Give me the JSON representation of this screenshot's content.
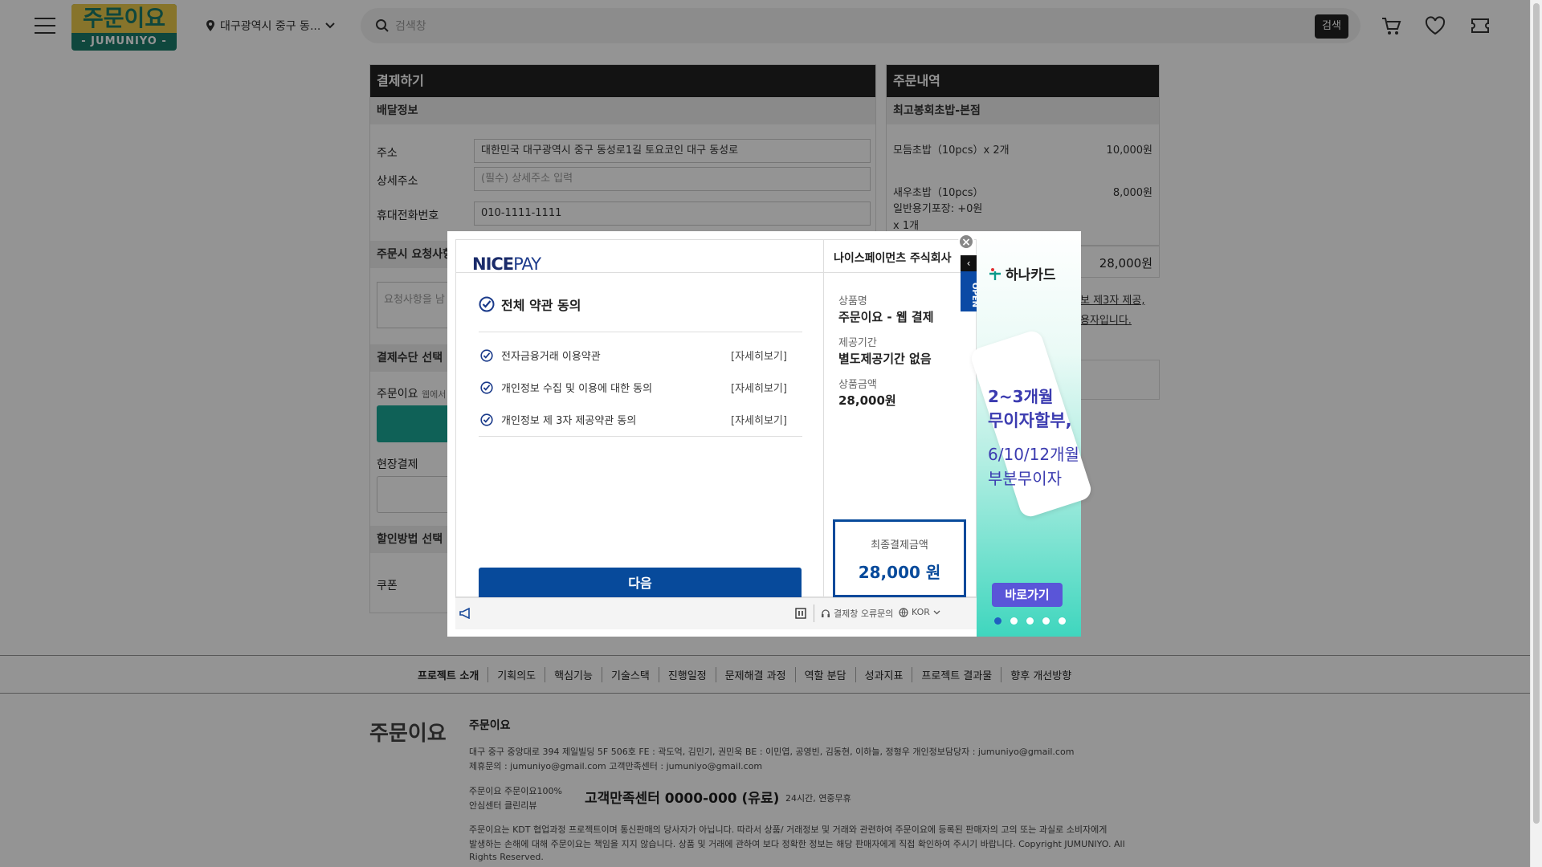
{
  "header": {
    "location": "대구광역시 중구 동...",
    "search_placeholder": "검색창",
    "search_button": "검색",
    "logo_top": "주문이요",
    "logo_bottom": "- JUMUNIYO -"
  },
  "checkout": {
    "title": "결제하기",
    "delivery_section": "배달정보",
    "address_label": "주소",
    "address_value": "대한민국 대구광역시 중구 동성로1길 토요코인 대구 동성로",
    "detail_label": "상세주소",
    "detail_placeholder": "(필수) 상세주소 입력",
    "phone_label": "휴대전화번호",
    "phone_value": "010-1111-1111",
    "request_section": "주문시 요청사항",
    "request_placeholder": "요청사항을 남",
    "payment_section": "결제수단 선택",
    "jumuniyo_label": "주문이요",
    "jumuniyo_sub": "웹에서",
    "onsite_label": "현장결제",
    "discount_section": "할인방법 선택",
    "coupon_label": "쿠폰"
  },
  "order": {
    "title": "주문내역",
    "store": "최고봉회초밥-본점",
    "items": [
      {
        "name": "모듬초밥（10pcs）x 2개",
        "price": "10,000원"
      },
      {
        "name": "새우초밥（10pcs）",
        "price": "8,000원",
        "opt": "일반용기포장: +0원",
        "qty": "x 1개"
      }
    ],
    "total": "28,000원",
    "notice1": "보 제3자 제공,",
    "notice2": "용자입니다."
  },
  "modal": {
    "brand_a": "NICE",
    "brand_b": "PAY",
    "agree_all": "전체 약관 동의",
    "terms": [
      {
        "label": "전자금융거래 이용약관",
        "detail": "[자세히보기]"
      },
      {
        "label": "개인정보 수집 및 이용에 대한 동의",
        "detail": "[자세히보기]"
      },
      {
        "label": "개인정보 제 3자 제공약관 동의",
        "detail": "[자세히보기]"
      }
    ],
    "next": "다음",
    "company": "나이스페이먼츠 주식회사",
    "product_label": "상품명",
    "product_value": "주문이요 - 웹 결제",
    "period_label": "제공기간",
    "period_value": "별도제공기간 없음",
    "amount_label": "상품금액",
    "amount_value": "28,000원",
    "final_label": "최종결제금액",
    "final_value": "28,000 원",
    "error_report": "결제창 오류문의",
    "lang": "KOR",
    "open_tab": "OPEN"
  },
  "ad": {
    "brand": "하나카드",
    "line1": "2~3개월",
    "line2": "무이자할부,",
    "line3": "6/10/12개월",
    "line4": "부분무이자",
    "go": "바로가기"
  },
  "footer": {
    "nav": [
      "프로젝트 소개",
      "기획의도",
      "핵심기능",
      "기술스택",
      "진행일정",
      "문제해결 과정",
      "역할 분담",
      "성과지표",
      "프로젝트 결과물",
      "향후 개선방향"
    ],
    "logo": "주문이요",
    "title": "주문이요",
    "addr": "대구 중구 중앙대로 394 제일빌딩 5F 506호    FE : 곽도억, 김민기, 권민욱    BE : 이민엽, 공영빈, 김동현, 이하늘, 정형우    개인정보담당자 : jumuniyo@gmail.com",
    "contact": "제휴문의 : jumuniyo@gmail.com    고객만족센터 : jumuniyo@gmail.com",
    "links1": "주문이요    주문이요100%",
    "links2": "안심센터    클린리뷰",
    "cs": "고객만족센터 0000-000 (유료)",
    "cs_hours": "24시간, 연중무휴",
    "disclaimer1": "주문이요는 KDT 협업과정 프로젝트이며 통신판매의 당사자가 아닙니다. 따라서 상품/ 거래정보 및 거래와 관련하여 주문이요에 등록된 판매자의 고의 또는 과실로 소비자에게",
    "disclaimer2": "발생하는 손해에 대해 주문이요는 책임을 지지 않습니다. 상품 및 거래에 관하여 보다 정확한 정보는 해당 판매자에게 직접 확인하여 주시기 바랍니다. Copyright JUMUNIYO. All",
    "disclaimer3": "Rights Reserved."
  }
}
